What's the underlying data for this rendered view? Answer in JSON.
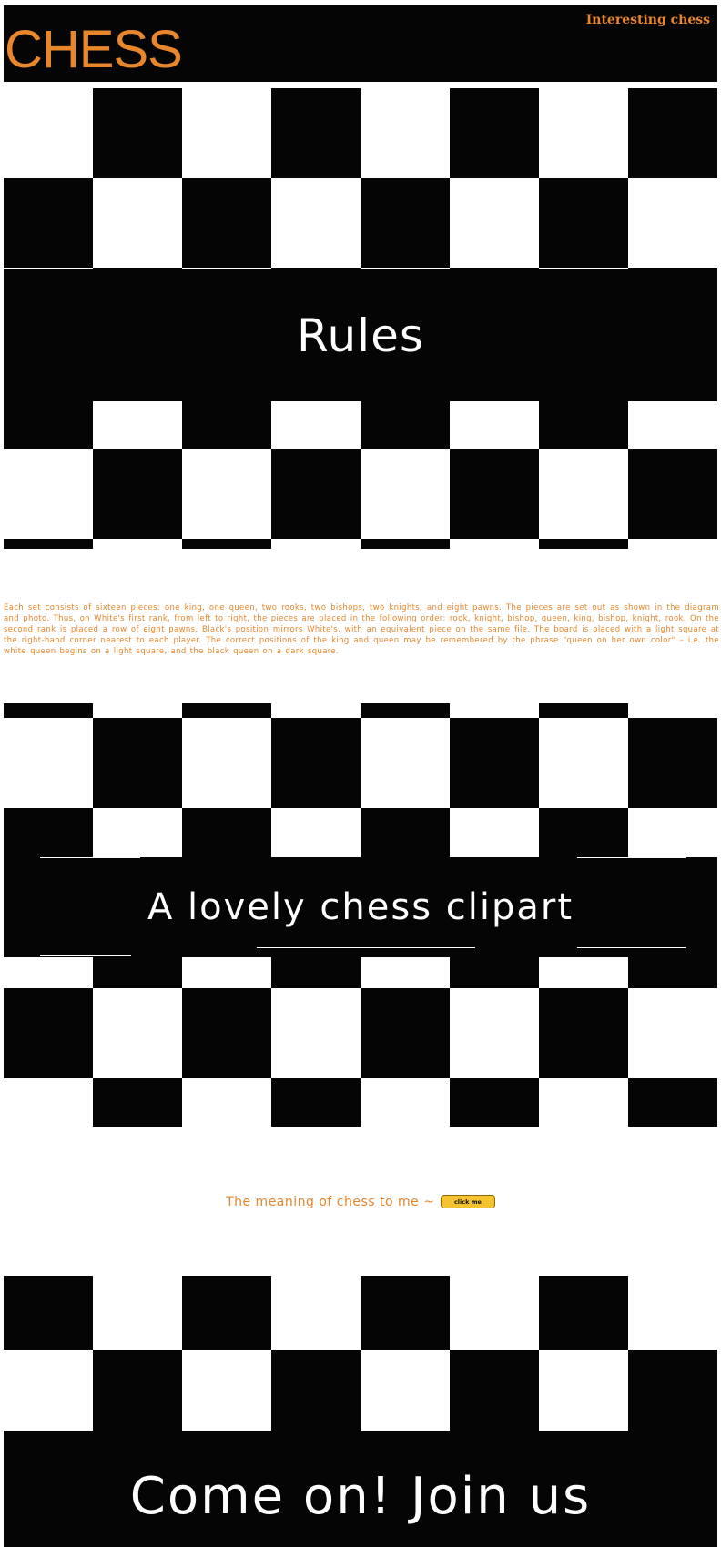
{
  "colors": {
    "accent": "#e8862c",
    "dark": "#050505",
    "light": "#ffffff",
    "button": "#f5c330"
  },
  "header": {
    "title": "CHESS",
    "tagline": "Interesting chess"
  },
  "sections": {
    "rules_heading": "Rules",
    "rules_text": "Each set consists of sixteen pieces: one king, one queen, two rooks, two bishops, two knights, and eight pawns. The pieces are set out as shown in the diagram and photo. Thus, on White's first rank, from left to right, the pieces are placed in the following order: rook, knight, bishop, queen, king, bishop, knight, rook. On the second rank is placed a row of eight pawns. Black's position mirrors White's, with an equivalent piece on the same file. The board is placed with a light square at the right-hand corner nearest to each player. The correct positions of the king and queen may be remembered by the phrase \"queen on her own color\" – i.e. the white queen begins on a light square, and the black queen on a dark square.",
    "clipart_heading": "A lovely chess clipart",
    "meaning_label": "The meaning of chess to me ~",
    "meaning_button": "click me",
    "join_heading": "Come on!  Join us"
  }
}
